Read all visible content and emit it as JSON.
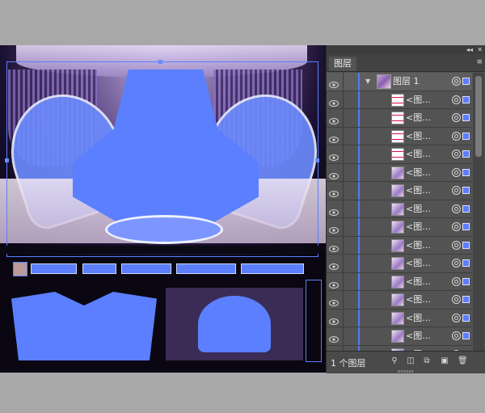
{
  "panel": {
    "tab_label": "图层",
    "parent_layer_label": "图层 1",
    "sublayer_label": "<图...",
    "layer_count_label": "1 个图层",
    "row_types": [
      "line",
      "line",
      "line",
      "line",
      "img",
      "img",
      "img",
      "img",
      "img",
      "img",
      "img",
      "img",
      "img",
      "img",
      "img",
      "img"
    ],
    "accent_color": "#4f7bff"
  }
}
